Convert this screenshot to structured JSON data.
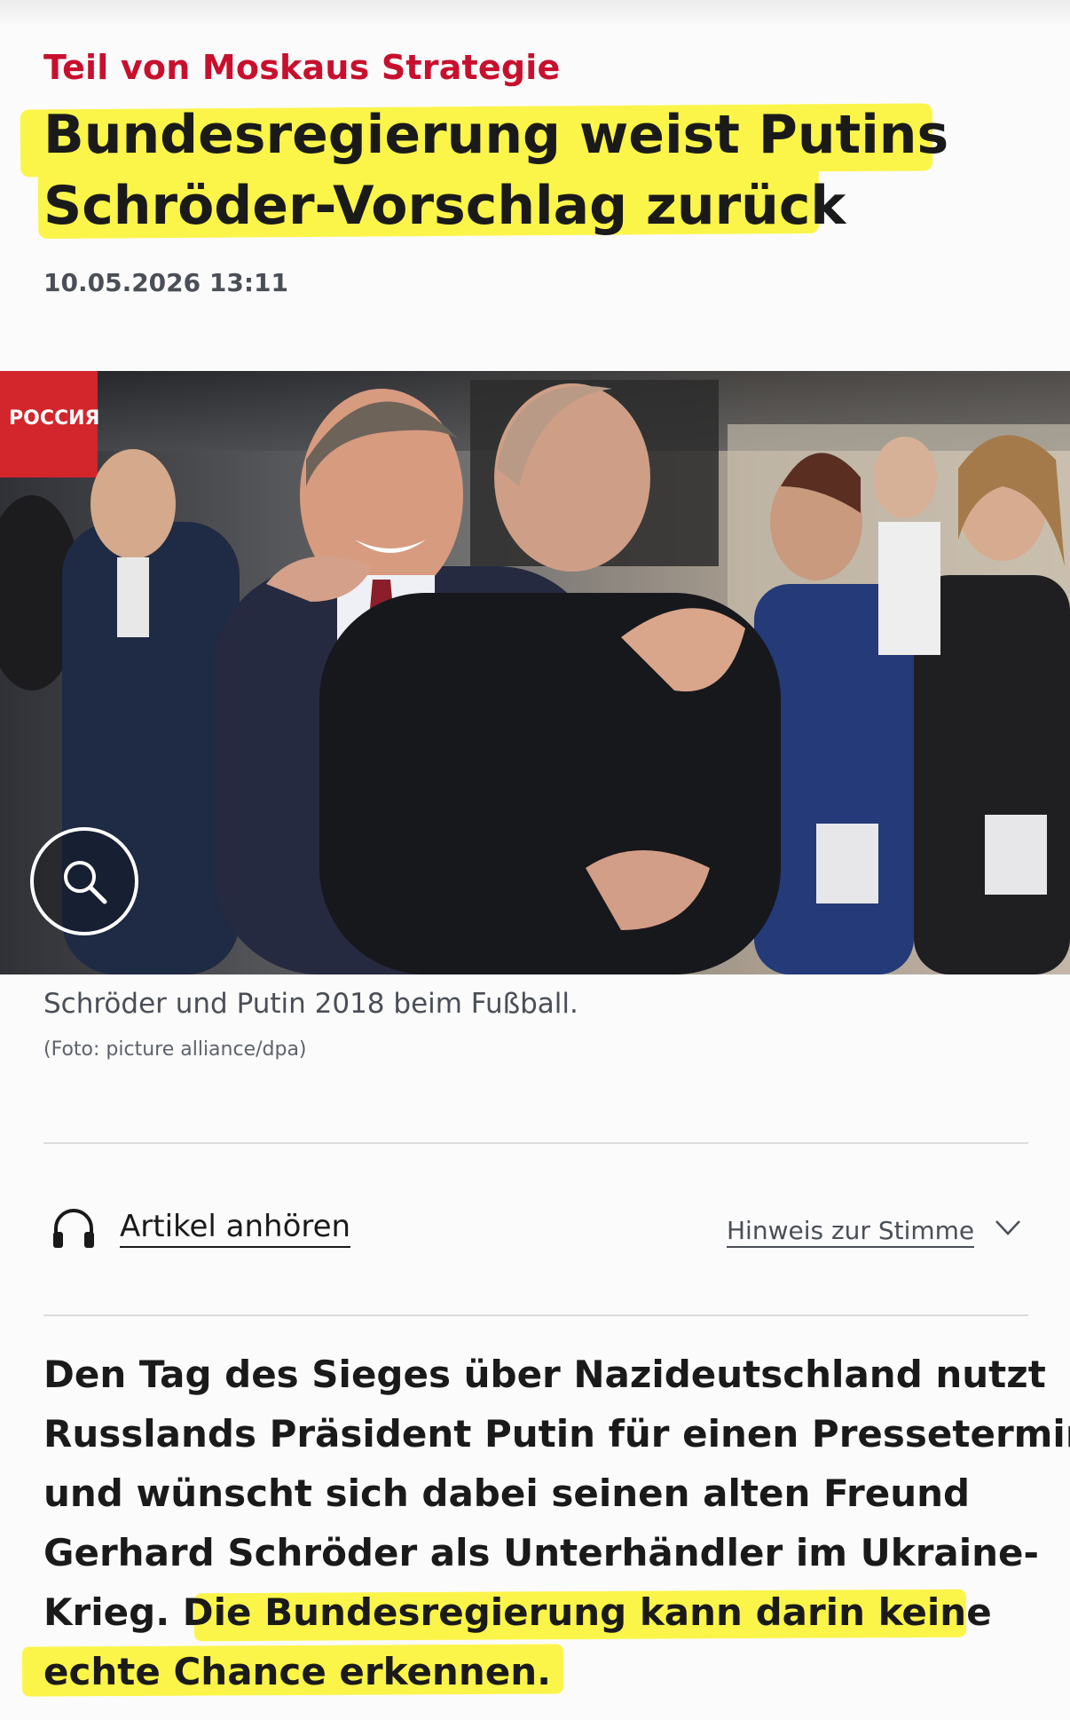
{
  "article": {
    "kicker": "Teil von Moskaus Strategie",
    "headline_lines": [
      "Bundesregierung weist Putins",
      "Schröder-Vorschlag zurück"
    ],
    "date": "10.05.2026 13:11",
    "image_caption": "Schröder und Putin 2018 beim Fußball.",
    "image_credit": "(Foto: picture alliance/dpa)",
    "lead_lines": [
      "Den Tag des Sieges über Nazideutschland nutzt",
      "Russlands Präsident Putin für einen Pressetermin",
      "und wünscht sich dabei seinen alten Freund",
      "Gerhard Schröder als Unterhändler im Ukraine-"
    ],
    "lead_line5_plain": "Krieg. D",
    "lead_line5_marked": "ie Bundesregierung kann darin keine",
    "lead_line6_marked": "echte Chance erkennen."
  },
  "audio": {
    "listen_label": "Artikel anhören",
    "voice_note_label": "Hinweis zur Stimme"
  },
  "photo_overlay_text": "РОССИЯ",
  "icons": {
    "zoom": "magnifier-icon",
    "audio": "headphones-icon",
    "expand": "chevron-down-icon"
  },
  "colors": {
    "kicker": "#c8102e",
    "highlight": "#fbf54a",
    "text": "#1a1a1a",
    "meta": "#4a4f57"
  }
}
